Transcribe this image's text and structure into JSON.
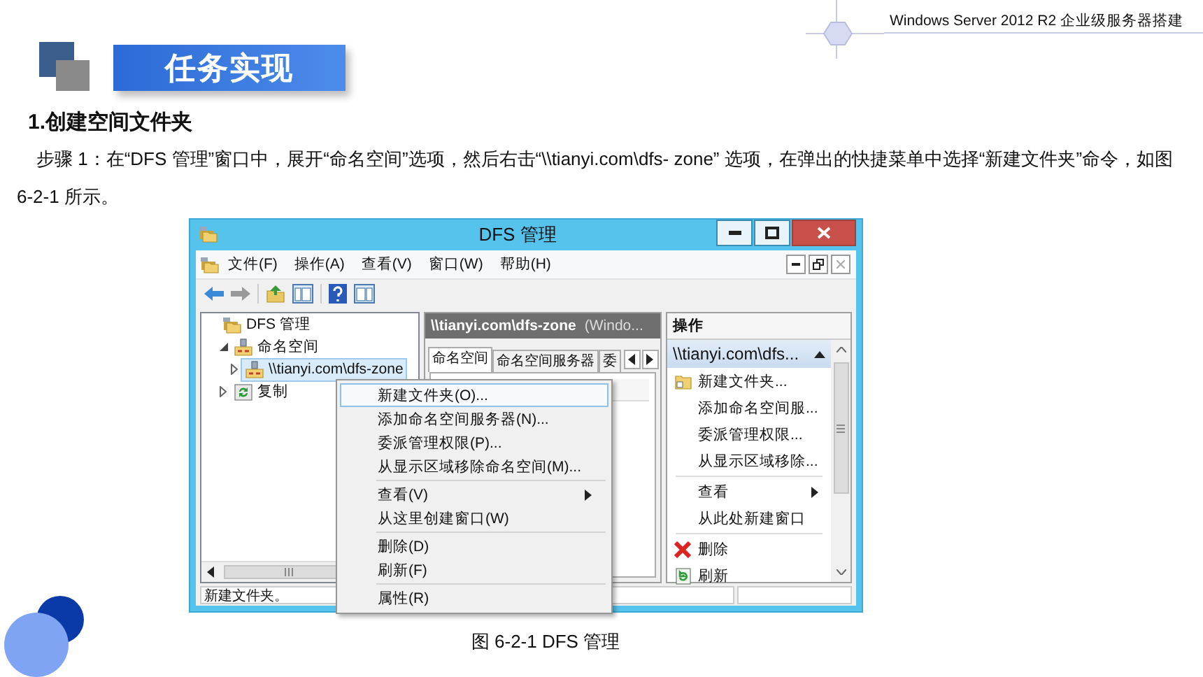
{
  "header": {
    "subtitle": "Windows Server 2012 R2 企业级服务器搭建",
    "banner": "任务实现"
  },
  "heading": "1.创建空间文件夹",
  "paragraph": "步骤 1：在“DFS 管理”窗口中，展开“命名空间”选项，然后右击“\\\\tianyi.com\\dfs- zone” 选项，在弹出的快捷菜单中选择“新建文件夹”命令，如图 6-2-1 所示。",
  "window": {
    "title": "DFS 管理",
    "menu": [
      "文件(F)",
      "操作(A)",
      "查看(V)",
      "窗口(W)",
      "帮助(H)"
    ],
    "tree": [
      {
        "label": "DFS 管理",
        "kind": "dfs",
        "selected": false,
        "children": [
          {
            "label": "命名空间",
            "kind": "namespaces",
            "selected": false,
            "expanded": true,
            "children": [
              {
                "label": "\\\\tianyi.com\\dfs-zone",
                "kind": "namespace",
                "selected": true,
                "expanded": false
              }
            ]
          },
          {
            "label": "复制",
            "kind": "replication",
            "selected": false,
            "expanded": false
          }
        ]
      }
    ],
    "center_pane": {
      "header": "\\\\tianyi.com\\dfs-zone",
      "header_note": "(Windo...",
      "tabs": [
        {
          "label": "命名空间",
          "selected": true
        },
        {
          "label": "命名空间服务器",
          "selected": false
        },
        {
          "label": "委",
          "selected": false
        }
      ]
    },
    "actions": {
      "title": "操作",
      "section": "\\\\tianyi.com\\dfs...",
      "groups": [
        [
          {
            "label": "新建文件夹...",
            "kind": "folder",
            "submenu": false
          },
          {
            "label": "添加命名空间服...",
            "kind": "plain",
            "submenu": false
          },
          {
            "label": "委派管理权限...",
            "kind": "plain",
            "submenu": false
          },
          {
            "label": "从显示区域移除...",
            "kind": "plain",
            "submenu": false
          }
        ],
        [
          {
            "label": "查看",
            "kind": "plain",
            "submenu": true
          },
          {
            "label": "从此处新建窗口",
            "kind": "plain",
            "submenu": false
          }
        ],
        [
          {
            "label": "删除",
            "kind": "delete",
            "submenu": false
          },
          {
            "label": "刷新",
            "kind": "refresh",
            "submenu": false
          }
        ]
      ]
    },
    "status_bar": "新建文件夹。",
    "context_menu": {
      "groups": [
        [
          {
            "label": "新建文件夹(O)...",
            "selected": true,
            "submenu": false
          },
          {
            "label": "添加命名空间服务器(N)...",
            "selected": false,
            "submenu": false
          },
          {
            "label": "委派管理权限(P)...",
            "selected": false,
            "submenu": false
          },
          {
            "label": "从显示区域移除命名空间(M)...",
            "selected": false,
            "submenu": false
          }
        ],
        [
          {
            "label": "查看(V)",
            "selected": false,
            "submenu": true
          },
          {
            "label": "从这里创建窗口(W)",
            "selected": false,
            "submenu": false
          }
        ],
        [
          {
            "label": "删除(D)",
            "selected": false,
            "submenu": false
          },
          {
            "label": "刷新(F)",
            "selected": false,
            "submenu": false
          }
        ],
        [
          {
            "label": "属性(R)",
            "selected": false,
            "submenu": false
          }
        ]
      ]
    }
  },
  "caption": "图 6-2-1  DFS 管理"
}
